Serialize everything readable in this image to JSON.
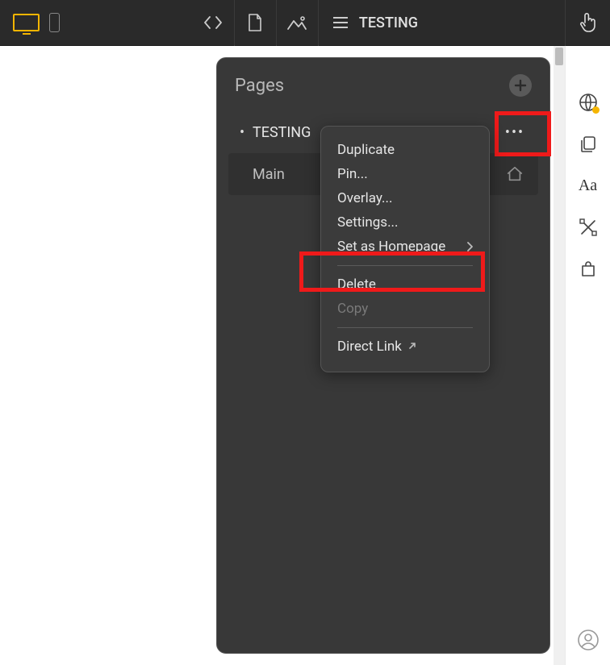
{
  "topbar": {
    "title": "TESTING"
  },
  "pages_panel": {
    "title": "Pages",
    "items": [
      {
        "label": "TESTING",
        "active": true
      },
      {
        "label": "Main",
        "active": false
      }
    ]
  },
  "context_menu": {
    "duplicate": "Duplicate",
    "pin": "Pin...",
    "overlay": "Overlay...",
    "settings": "Settings...",
    "set_homepage": "Set as Homepage",
    "delete": "Delete",
    "copy": "Copy",
    "direct_link": "Direct Link"
  },
  "right_rail": {
    "typography_label": "Aa"
  }
}
